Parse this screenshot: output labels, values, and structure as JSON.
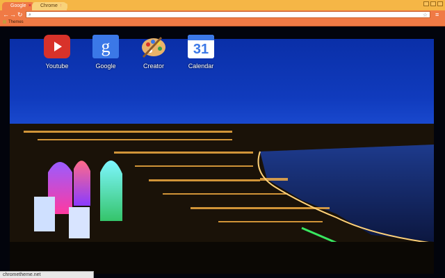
{
  "tabs": [
    {
      "label": "Google",
      "active": true
    },
    {
      "label": "Chrome",
      "active": false
    }
  ],
  "toolbar": {
    "back_icon": "back-arrow-icon",
    "forward_icon": "forward-arrow-icon",
    "reload_icon": "reload-icon",
    "omnibox_value": ""
  },
  "bookmarks": [
    {
      "label": "Themes"
    }
  ],
  "shortcuts": [
    {
      "label": "Youtube",
      "icon": "youtube-icon"
    },
    {
      "label": "Google",
      "icon": "google-icon"
    },
    {
      "label": "Creator",
      "icon": "palette-icon"
    },
    {
      "label": "Calendar",
      "icon": "calendar-icon",
      "number": "31"
    }
  ],
  "status": {
    "text": "chrometheme.net"
  },
  "colors": {
    "frame": "#f5b646",
    "toolbar": "#f07a45",
    "sky": "#103bbd"
  }
}
